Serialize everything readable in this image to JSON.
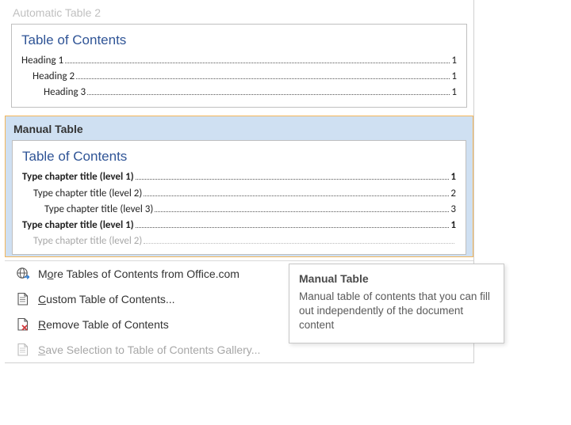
{
  "gallery": {
    "auto2": {
      "title": "Automatic Table 2",
      "toc_title": "Table of Contents",
      "rows": [
        {
          "label": "Heading 1",
          "page": "1",
          "indent": 0
        },
        {
          "label": "Heading 2",
          "page": "1",
          "indent": 1
        },
        {
          "label": "Heading 3",
          "page": "1",
          "indent": 2
        }
      ]
    },
    "manual": {
      "title": "Manual Table",
      "toc_title": "Table of Contents",
      "rows": [
        {
          "label": "Type chapter title (level 1)",
          "page": "1",
          "indent": 0,
          "bold": true
        },
        {
          "label": "Type chapter title (level 2)",
          "page": "2",
          "indent": 1
        },
        {
          "label": "Type chapter title (level 3)",
          "page": "3",
          "indent": 2
        },
        {
          "label": "Type chapter title (level 1)",
          "page": "1",
          "indent": 0,
          "bold": true
        },
        {
          "label": "Type chapter title (level 2)",
          "page": "",
          "indent": 1
        }
      ]
    }
  },
  "menu": {
    "more_pre": "M",
    "more_u": "o",
    "more_post": "re Tables of Contents from Office.com",
    "custom_u": "C",
    "custom_post": "ustom Table of Contents...",
    "remove_u": "R",
    "remove_post": "emove Table of Contents",
    "save_u": "S",
    "save_post": "ave Selection to Table of Contents Gallery..."
  },
  "tooltip": {
    "title": "Manual Table",
    "body": "Manual table of contents that you can fill out independently of the document content"
  }
}
